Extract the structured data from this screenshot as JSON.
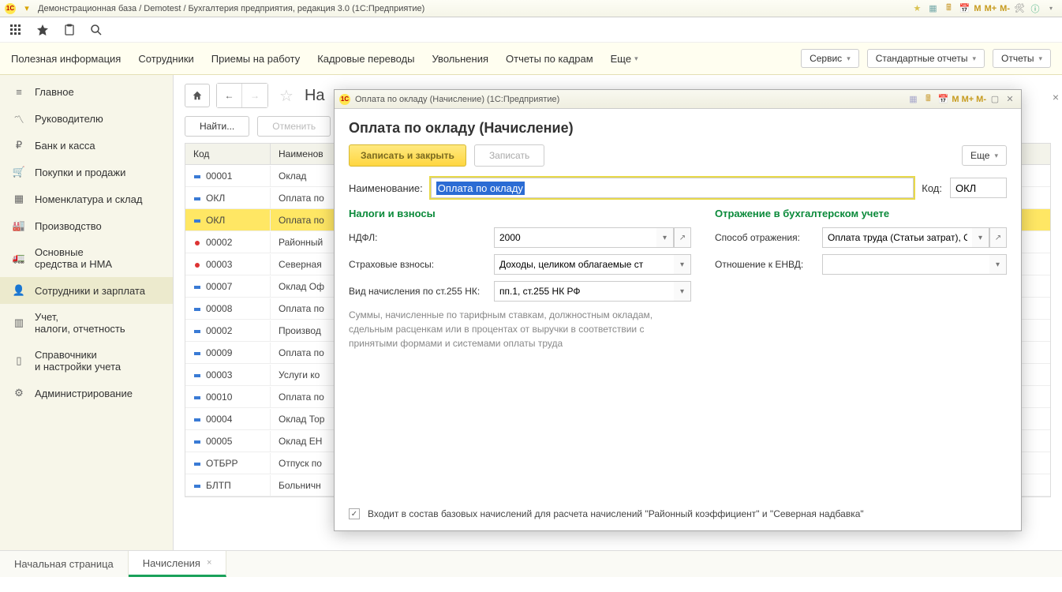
{
  "window_title": "Демонстрационная база / Demotest / Бухгалтерия предприятия, редакция 3.0  (1С:Предприятие)",
  "titlebar_m": [
    "M",
    "M+",
    "M-"
  ],
  "nav": {
    "links": [
      "Полезная информация",
      "Сотрудники",
      "Приемы на работу",
      "Кадровые переводы",
      "Увольнения",
      "Отчеты по кадрам"
    ],
    "more": "Еще",
    "buttons": [
      "Сервис",
      "Стандартные отчеты",
      "Отчеты"
    ]
  },
  "sidebar": [
    "Главное",
    "Руководителю",
    "Банк и касса",
    "Покупки и продажи",
    "Номенклатура и склад",
    "Производство",
    "Основные\nсредства и НМА",
    "Сотрудники и зарплата",
    "Учет,\nналоги, отчетность",
    "Справочники\nи настройки учета",
    "Администрирование"
  ],
  "page_title_partial": "На",
  "filter": {
    "find": "Найти...",
    "cancel": "Отменить"
  },
  "grid": {
    "head": {
      "code": "Код",
      "name": "Наименов"
    },
    "rows": [
      {
        "code": "00001",
        "name": "Оклад",
        "ic": "blue"
      },
      {
        "code": "ОКЛ",
        "name": "Оплата по",
        "ic": "blue"
      },
      {
        "code": "ОКЛ",
        "name": "Оплата по",
        "ic": "blue",
        "sel": true
      },
      {
        "code": "00002",
        "name": "Районный",
        "ic": "red"
      },
      {
        "code": "00003",
        "name": "Северная",
        "ic": "red"
      },
      {
        "code": "00007",
        "name": "Оклад Оф",
        "ic": "blue"
      },
      {
        "code": "00008",
        "name": "Оплата по",
        "ic": "blue"
      },
      {
        "code": "00002",
        "name": "Производ",
        "ic": "blue"
      },
      {
        "code": "00009",
        "name": "Оплата по",
        "ic": "blue"
      },
      {
        "code": "00003",
        "name": "Услуги ко",
        "ic": "blue"
      },
      {
        "code": "00010",
        "name": "Оплата по",
        "ic": "blue"
      },
      {
        "code": "00004",
        "name": "Оклад Тор",
        "ic": "blue"
      },
      {
        "code": "00005",
        "name": "Оклад ЕН",
        "ic": "blue"
      },
      {
        "code": "ОТБРР",
        "name": "Отпуск по",
        "ic": "blue"
      },
      {
        "code": "БЛТП",
        "name": "Больничн",
        "ic": "blue"
      }
    ]
  },
  "dialog": {
    "wintitle": "Оплата по окладу (Начисление) (1С:Предприятие)",
    "heading": "Оплата по окладу (Начисление)",
    "btn_save_close": "Записать и закрыть",
    "btn_save": "Записать",
    "btn_more": "Еще",
    "name_lbl": "Наименование:",
    "name_val": "Оплата по окладу",
    "code_lbl": "Код:",
    "code_val": "ОКЛ",
    "sect_tax": "Налоги и взносы",
    "sect_acc": "Отражение в бухгалтерском учете",
    "ndfl_lbl": "НДФЛ:",
    "ndfl_val": "2000",
    "ins_lbl": "Страховые взносы:",
    "ins_val": "Доходы, целиком облагаемые ст",
    "kind_lbl": "Вид начисления по ст.255 НК:",
    "kind_val": "пп.1, ст.255 НК РФ",
    "acc_method_lbl": "Способ отражения:",
    "acc_method_val": "Оплата труда (Статьи затрат), Ог",
    "envd_lbl": "Отношение к ЕНВД:",
    "envd_val": "",
    "desc": "Суммы, начисленные по тарифным ставкам, должностным окладам, сдельным расценкам или в процентах от выручки в соответствии с принятыми формами и системами оплаты труда",
    "footer_check": "Входит в состав базовых начислений для расчета начислений \"Районный коэффициент\" и \"Северная надбавка\""
  },
  "tabs": [
    "Начальная страница",
    "Начисления"
  ]
}
